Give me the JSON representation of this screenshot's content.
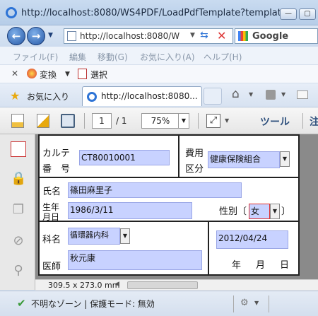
{
  "window": {
    "title": "http://localhost:8080/WS4PDF/LoadPdfTemplate?templat..."
  },
  "address": {
    "url": "http://localhost:8080/W"
  },
  "search": {
    "label": "Google"
  },
  "menu": [
    "ファイル(F)",
    "編集",
    "移動(G)",
    "お気に入り(A)",
    "ヘルプ(H)"
  ],
  "links": {
    "convert": "変換",
    "select": "選択"
  },
  "favorites": {
    "label": "お気に入り",
    "tab_title": "http://localhost:8080..."
  },
  "pdf_toolbar": {
    "page": "1",
    "page_total": "/ 1",
    "zoom": "75%",
    "tools": "ツール",
    "annot": "注"
  },
  "form": {
    "karute_label_1": "カルテ",
    "karute_label_2": "番　号",
    "karute_value": "CT80010001",
    "hiyo_label_1": "費用",
    "hiyo_label_2": "区分",
    "hiyo_value": "健康保険組合",
    "name_label": "氏名",
    "name_value": "篠田麻里子",
    "birth_label_1": "生年",
    "birth_label_2": "月日",
    "birth_value": "1986/3/11",
    "sex_label": "性別〔",
    "sex_value": "女",
    "sex_close": "〕",
    "dept_label": "科名",
    "dept_value": "循環器内科",
    "date_value": "2012/04/24",
    "doctor_label": "医師",
    "doctor_value": "秋元康",
    "date_year": "年",
    "date_month": "月",
    "date_day": "日"
  },
  "page_size": "309.5 x 273.0 mm",
  "status": {
    "zone": "不明なゾーン | 保護モード: 無効"
  }
}
